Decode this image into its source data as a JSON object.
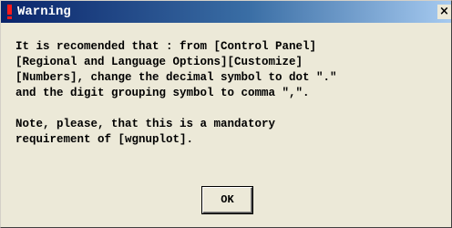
{
  "window": {
    "title": "Warning",
    "close_label": "×",
    "title_icon": "warning-exclamation-icon",
    "close_icon": "close-icon"
  },
  "message": {
    "line1": "It is recomended that : from [Control Panel]",
    "line2": "[Regional and Language Options][Customize]",
    "line3": "[Numbers], change the decimal symbol to dot \".\"",
    "line4": "and the digit grouping symbol to comma \",\".",
    "line5": "",
    "line6": "Note, please, that this is a mandatory",
    "line7": "requirement of [wgnuplot]."
  },
  "buttons": {
    "ok_label": "OK"
  },
  "colors": {
    "titlebar_start": "#0a246a",
    "titlebar_end": "#a6caf0",
    "dialog_background": "#ece9d8",
    "warning_icon": "#ff1a1a"
  }
}
